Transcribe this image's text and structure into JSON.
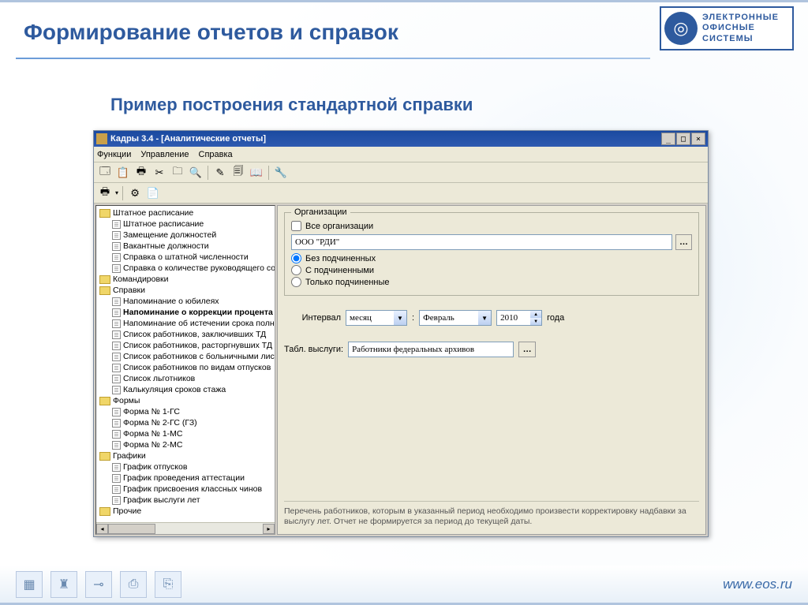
{
  "slide": {
    "title": "Формирование отчетов и справок",
    "subtitle": "Пример построения стандартной справки",
    "logo_lines": [
      "ЭЛЕКТРОННЫЕ",
      "ОФИСНЫЕ",
      "СИСТЕМЫ"
    ],
    "footer_url": "www.eos.ru"
  },
  "window": {
    "title": "Кадры 3.4 - [Аналитические отчеты]",
    "menu": [
      "Функции",
      "Управление",
      "Справка"
    ]
  },
  "tree": [
    {
      "type": "folder",
      "label": "Штатное расписание"
    },
    {
      "type": "leaf",
      "label": "Штатное расписание"
    },
    {
      "type": "leaf",
      "label": "Замещение должностей"
    },
    {
      "type": "leaf",
      "label": "Вакантные должности"
    },
    {
      "type": "leaf",
      "label": "Справка о штатной численности"
    },
    {
      "type": "leaf",
      "label": "Справка о количестве руководящего сос"
    },
    {
      "type": "folder",
      "label": "Командировки"
    },
    {
      "type": "folder",
      "label": "Справки"
    },
    {
      "type": "leaf",
      "label": "Напоминание о юбилеях"
    },
    {
      "type": "leaf",
      "label": "Напоминание о коррекции процента",
      "bold": true
    },
    {
      "type": "leaf",
      "label": "Напоминание об истечении срока полном"
    },
    {
      "type": "leaf",
      "label": "Список работников, заключивших ТД"
    },
    {
      "type": "leaf",
      "label": "Список работников, расторгнувших ТД"
    },
    {
      "type": "leaf",
      "label": "Список работников с больничными листа"
    },
    {
      "type": "leaf",
      "label": "Список работников по видам отпусков"
    },
    {
      "type": "leaf",
      "label": "Список льготников"
    },
    {
      "type": "leaf",
      "label": "Калькуляция сроков стажа"
    },
    {
      "type": "folder",
      "label": "Формы"
    },
    {
      "type": "leaf",
      "label": "Форма № 1-ГС"
    },
    {
      "type": "leaf",
      "label": "Форма № 2-ГС (ГЗ)"
    },
    {
      "type": "leaf",
      "label": "Форма № 1-МС"
    },
    {
      "type": "leaf",
      "label": "Форма № 2-МС"
    },
    {
      "type": "folder",
      "label": "Графики"
    },
    {
      "type": "leaf",
      "label": "График отпусков"
    },
    {
      "type": "leaf",
      "label": "График проведения аттестации"
    },
    {
      "type": "leaf",
      "label": "График присвоения классных чинов"
    },
    {
      "type": "leaf",
      "label": "График выслуги лет"
    },
    {
      "type": "folder",
      "label": "Прочие"
    }
  ],
  "form": {
    "org_legend": "Организации",
    "all_orgs": "Все организации",
    "org_value": "ООО \"РДИ\"",
    "radio_nosub": "Без подчиненных",
    "radio_withsub": "С подчиненными",
    "radio_onlysub": "Только подчиненные",
    "interval_label": "Интервал",
    "interval_unit": "месяц",
    "interval_sep": ":",
    "month": "Февраль",
    "year": "2010",
    "year_suffix": "года",
    "table_label": "Табл. выслуги:",
    "table_value": "Работники федеральных архивов",
    "description": "Перечень работников, которым в указанный период необходимо произвести корректировку надбавки за выслугу лет. Отчет не формируется за период до текущей даты."
  }
}
